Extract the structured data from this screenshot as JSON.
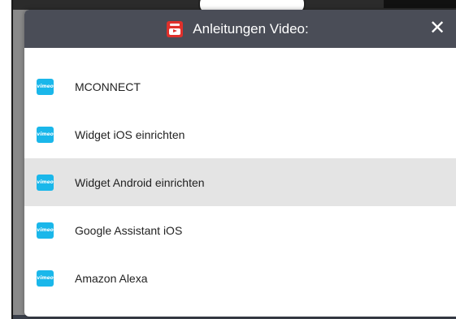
{
  "modal": {
    "title": "Anleitungen Video:",
    "title_icon": "youtube-icon",
    "close_label": "✕",
    "header_color": "#4a4d57"
  },
  "videos": [
    {
      "label": "MCONNECT",
      "icon": "vimeo-icon",
      "icon_text": "vimeo",
      "highlighted": false
    },
    {
      "label": "Widget iOS einrichten",
      "icon": "vimeo-icon",
      "icon_text": "vimeo",
      "highlighted": false
    },
    {
      "label": "Widget Android einrichten",
      "icon": "vimeo-icon",
      "icon_text": "vimeo",
      "highlighted": true
    },
    {
      "label": "Google Assistant iOS",
      "icon": "vimeo-icon",
      "icon_text": "vimeo",
      "highlighted": false
    },
    {
      "label": "Amazon Alexa",
      "icon": "vimeo-icon",
      "icon_text": "vimeo",
      "highlighted": false
    }
  ],
  "colors": {
    "vimeo_blue": "#1ab7ea",
    "youtube_red": "#e0302b",
    "highlight_bg": "#e4e4e4"
  }
}
